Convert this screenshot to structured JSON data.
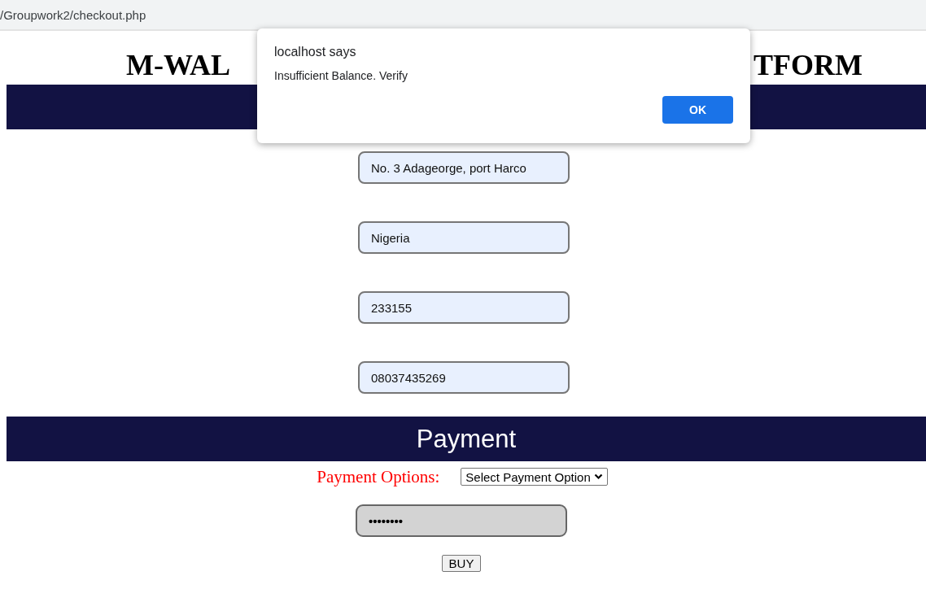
{
  "address_bar": {
    "url": "/Groupwork2/checkout.php"
  },
  "title_parts": [
    "M-WAL",
    "TFORM"
  ],
  "fields": [
    {
      "value": "No. 3 Adageorge, port Harco"
    },
    {
      "value": "Nigeria"
    },
    {
      "value": "233155"
    },
    {
      "value": "08037435269"
    }
  ],
  "payment": {
    "heading": "Payment",
    "options_label": "Payment Options:",
    "select": "Select Payment Option",
    "password": "••••••••",
    "buy_button": "BUY"
  },
  "dialog": {
    "title": "localhost says",
    "message": "Insufficient Balance. Verify",
    "ok_button": "OK"
  }
}
